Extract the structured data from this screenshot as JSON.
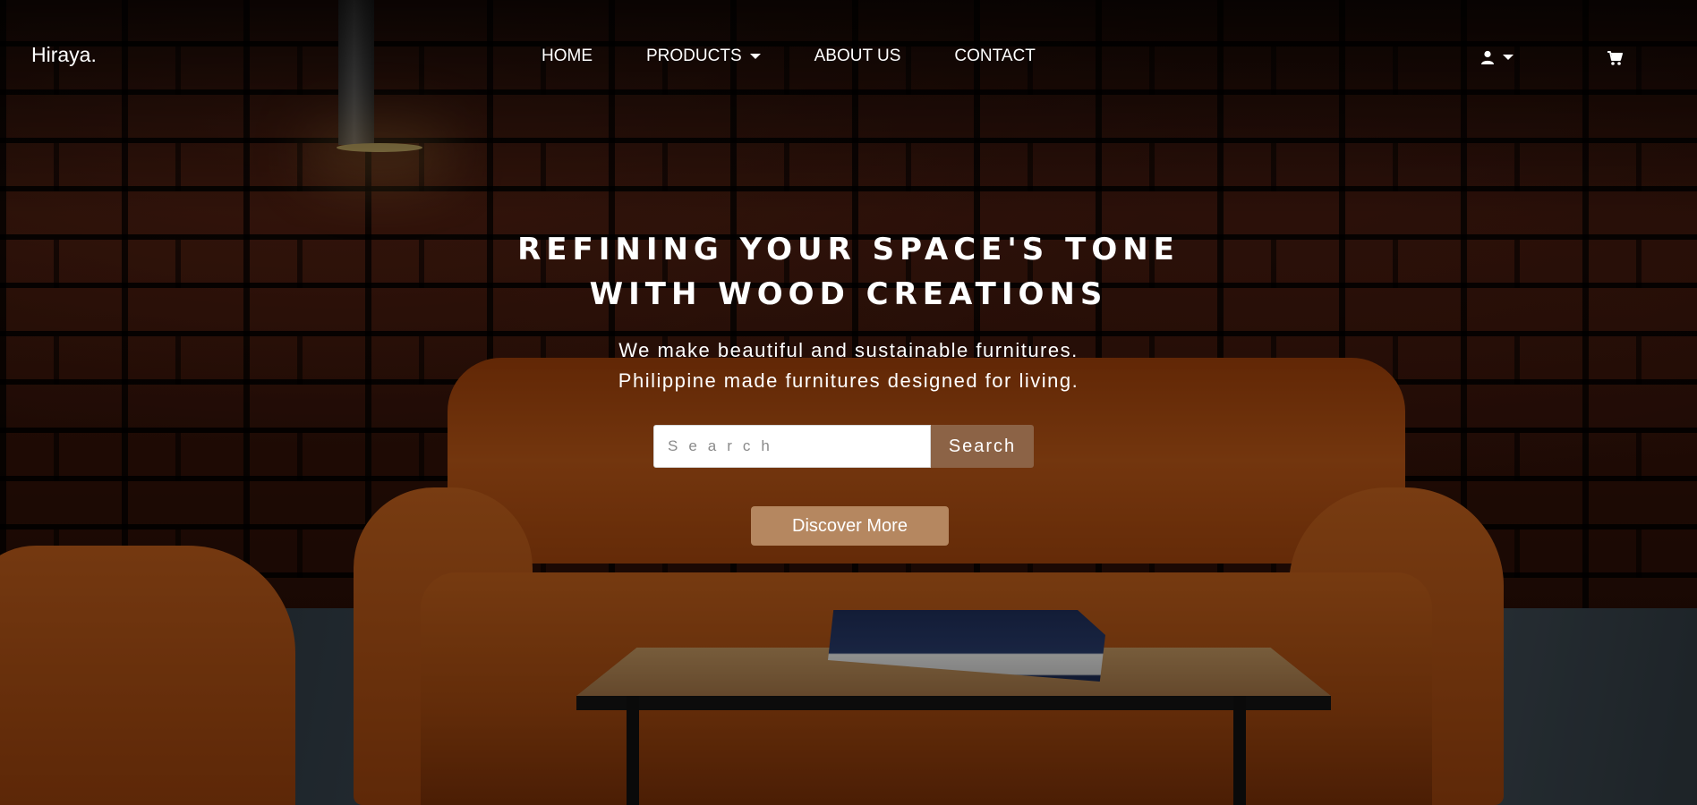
{
  "brand": {
    "name": "Hiraya."
  },
  "nav": {
    "items": [
      {
        "label": "HOME",
        "has_dropdown": false
      },
      {
        "label": "PRODUCTS",
        "has_dropdown": true
      },
      {
        "label": "ABOUT US",
        "has_dropdown": false
      },
      {
        "label": "CONTACT",
        "has_dropdown": false
      }
    ],
    "user_icon": "user-icon",
    "cart_icon": "cart-icon"
  },
  "hero": {
    "headline_line1": "REFINING YOUR SPACE'S TONE",
    "headline_line2": "WITH WOOD CREATIONS",
    "subline_line1": "We make beautiful and sustainable furnitures.",
    "subline_line2": "Philippine made furnitures designed for living.",
    "search_placeholder": "Search",
    "search_button": "Search",
    "cta_button": "Discover More"
  },
  "colors": {
    "search_button_bg": "#8c6346",
    "cta_button_bg": "#b58760",
    "text": "#ffffff"
  }
}
